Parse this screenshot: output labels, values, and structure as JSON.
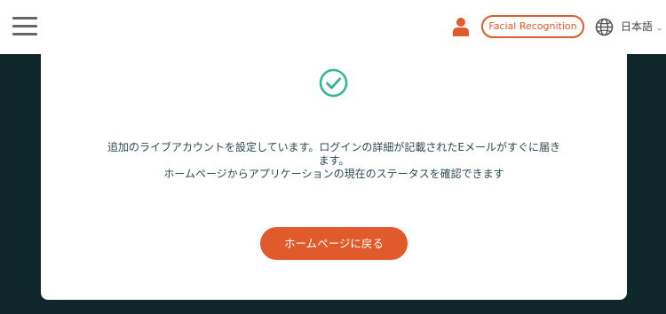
{
  "header": {
    "facial_recognition_label": "Facial Recognition",
    "language_label": "日本語",
    "accent_color": "#e05a2b"
  },
  "main": {
    "message_line1": "追加のライブアカウントを設定しています。ログインの詳細が記載されたEメールがすぐに届き",
    "message_line2": "ます。",
    "message_line3": "ホームページからアプリケーションの現在のステータスを確認できます",
    "home_button_label": "ホームページに戻る",
    "success_color": "#2fb58f"
  }
}
